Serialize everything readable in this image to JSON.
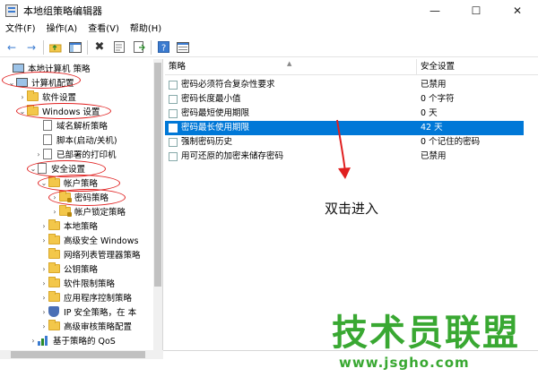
{
  "window": {
    "title": "本地组策略编辑器",
    "minimize": "—",
    "maximize": "☐",
    "close": "✕"
  },
  "menu": [
    "文件(F)",
    "操作(A)",
    "查看(V)",
    "帮助(H)"
  ],
  "toolbar": {
    "back": "←",
    "forward": "→",
    "delete": "✖",
    "help": "?"
  },
  "tree": [
    {
      "label": "本地计算机 策略",
      "toggle": "",
      "icon": "pc"
    },
    {
      "label": "计算机配置",
      "toggle": "⌄",
      "icon": "pc"
    },
    {
      "label": "软件设置",
      "toggle": "›",
      "icon": "folder"
    },
    {
      "label": "Windows 设置",
      "toggle": "⌄",
      "icon": "folder"
    },
    {
      "label": "域名解析策略",
      "toggle": "",
      "icon": "doc"
    },
    {
      "label": "脚本(启动/关机)",
      "toggle": "",
      "icon": "doc"
    },
    {
      "label": "已部署的打印机",
      "toggle": "›",
      "icon": "doc"
    },
    {
      "label": "安全设置",
      "toggle": "⌄",
      "icon": "doc"
    },
    {
      "label": "帐户策略",
      "toggle": "⌄",
      "icon": "folder"
    },
    {
      "label": "密码策略",
      "toggle": "›",
      "icon": "folderlock"
    },
    {
      "label": "帐户锁定策略",
      "toggle": "›",
      "icon": "folderlock"
    },
    {
      "label": "本地策略",
      "toggle": "›",
      "icon": "folder"
    },
    {
      "label": "高级安全 Windows",
      "toggle": "›",
      "icon": "folder"
    },
    {
      "label": "网络列表管理器策略",
      "toggle": "",
      "icon": "folder"
    },
    {
      "label": "公钥策略",
      "toggle": "›",
      "icon": "folder"
    },
    {
      "label": "软件限制策略",
      "toggle": "›",
      "icon": "folder"
    },
    {
      "label": "应用程序控制策略",
      "toggle": "›",
      "icon": "folder"
    },
    {
      "label": "IP 安全策略，在 本",
      "toggle": "›",
      "icon": "shield"
    },
    {
      "label": "高级审核策略配置",
      "toggle": "›",
      "icon": "folder"
    },
    {
      "label": "基于策略的 QoS",
      "toggle": "›",
      "icon": "chart"
    }
  ],
  "list": {
    "col_policy": "策略",
    "col_setting": "安全设置",
    "sort_arrow": "▲",
    "rows": [
      {
        "name": "密码必须符合复杂性要求",
        "value": "已禁用"
      },
      {
        "name": "密码长度最小值",
        "value": "0 个字符"
      },
      {
        "name": "密码最短使用期限",
        "value": "0 天"
      },
      {
        "name": "密码最长使用期限",
        "value": "42 天"
      },
      {
        "name": "强制密码历史",
        "value": "0 个记住的密码"
      },
      {
        "name": "用可还原的加密来储存密码",
        "value": "已禁用"
      }
    ],
    "selected_index": 3
  },
  "annotation": {
    "text": "双击进入",
    "color": "#e02020"
  },
  "watermark": {
    "text": "技术员联盟",
    "url": "www.jsgho.com",
    "color": "#39a832"
  },
  "colors": {
    "selection": "#0078d7",
    "folder": "#f3c74a"
  }
}
